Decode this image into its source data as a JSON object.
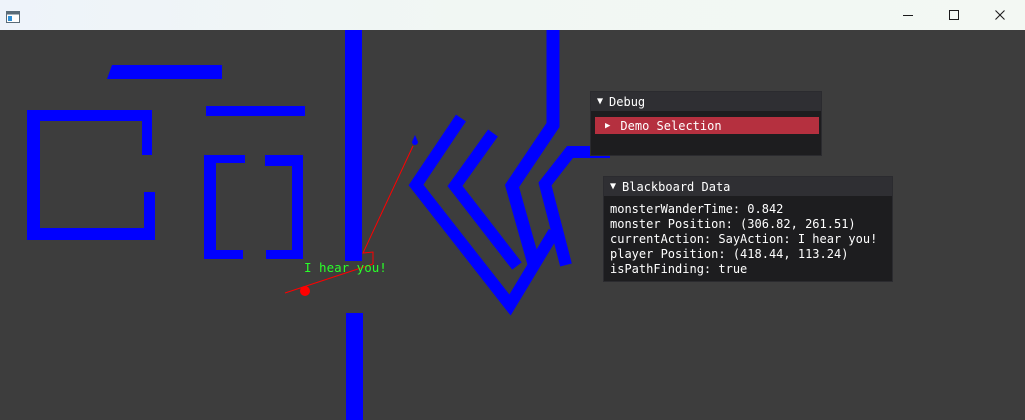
{
  "window": {
    "icon": "app-window-icon",
    "controls": [
      "minimize-icon",
      "maximize-icon",
      "close-icon"
    ]
  },
  "game": {
    "speech_text": "I hear you!",
    "colors": {
      "background": "#3d3d3d",
      "walls": "#0000ff",
      "agent": "#ff0000",
      "speech": "#29ff29"
    }
  },
  "debug_panel": {
    "title": "Debug",
    "items": [
      {
        "label": "Demo Selection",
        "expanded": false
      }
    ]
  },
  "blackboard_panel": {
    "title": "Blackboard Data",
    "lines": [
      "monsterWanderTime: 0.842",
      "monster Position: (306.82, 261.51)",
      "currentAction: SayAction: I hear you!",
      "player Position: (418.44, 113.24)",
      "isPathFinding: true"
    ]
  }
}
